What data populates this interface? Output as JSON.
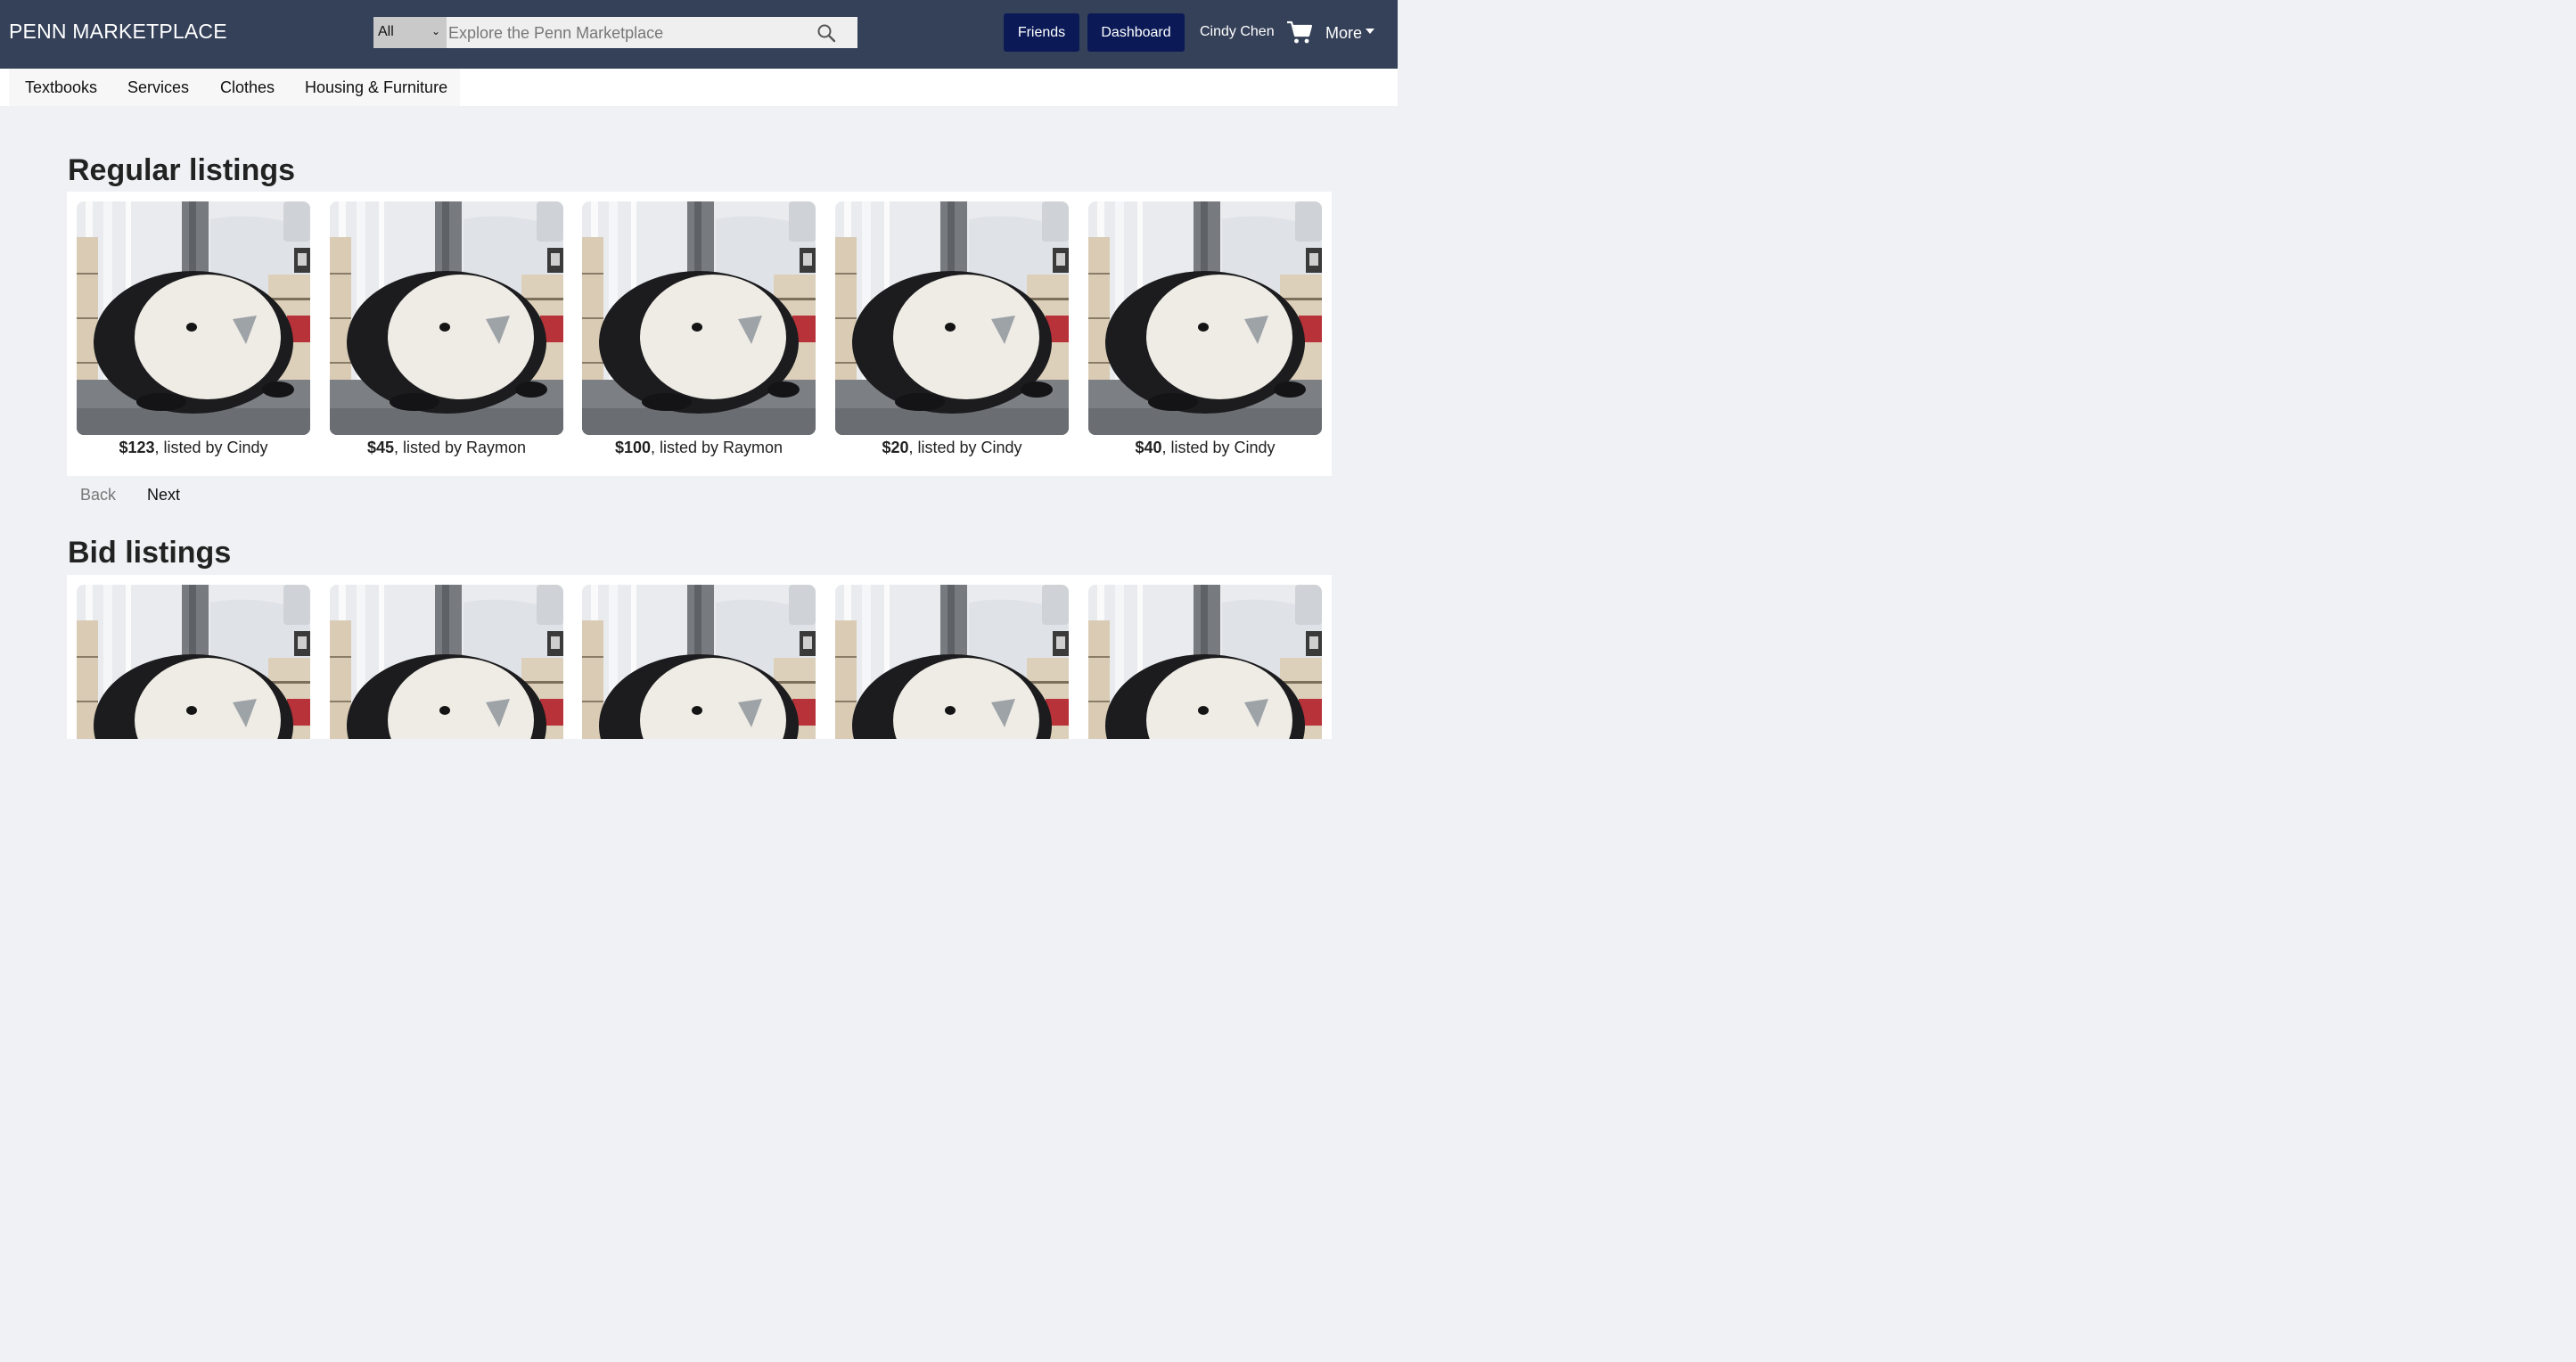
{
  "header": {
    "brand": "PENN MARKETPLACE",
    "search": {
      "category": "All",
      "placeholder": "Explore the Penn Marketplace"
    },
    "buttons": {
      "friends": "Friends",
      "dashboard": "Dashboard"
    },
    "user_name": "Cindy Chen",
    "more": "More"
  },
  "categories": [
    "Textbooks",
    "Services",
    "Clothes",
    "Housing & Furniture"
  ],
  "regular": {
    "title": "Regular listings",
    "listings": [
      {
        "price": "$123",
        "seller": ", listed by Cindy"
      },
      {
        "price": "$45",
        "seller": ", listed by Raymon"
      },
      {
        "price": "$100",
        "seller": ", listed by Raymon"
      },
      {
        "price": "$20",
        "seller": ", listed by Cindy"
      },
      {
        "price": "$40",
        "seller": ", listed by Cindy"
      }
    ],
    "pagination": {
      "back": "Back",
      "next": "Next"
    }
  },
  "bid": {
    "title": "Bid listings"
  },
  "colors": {
    "header_bg": "#354159",
    "button_bg": "#0b1a57",
    "page_bg": "#f0f1f4"
  },
  "icons": [
    "search-icon",
    "cart-icon",
    "caret-down-icon"
  ]
}
